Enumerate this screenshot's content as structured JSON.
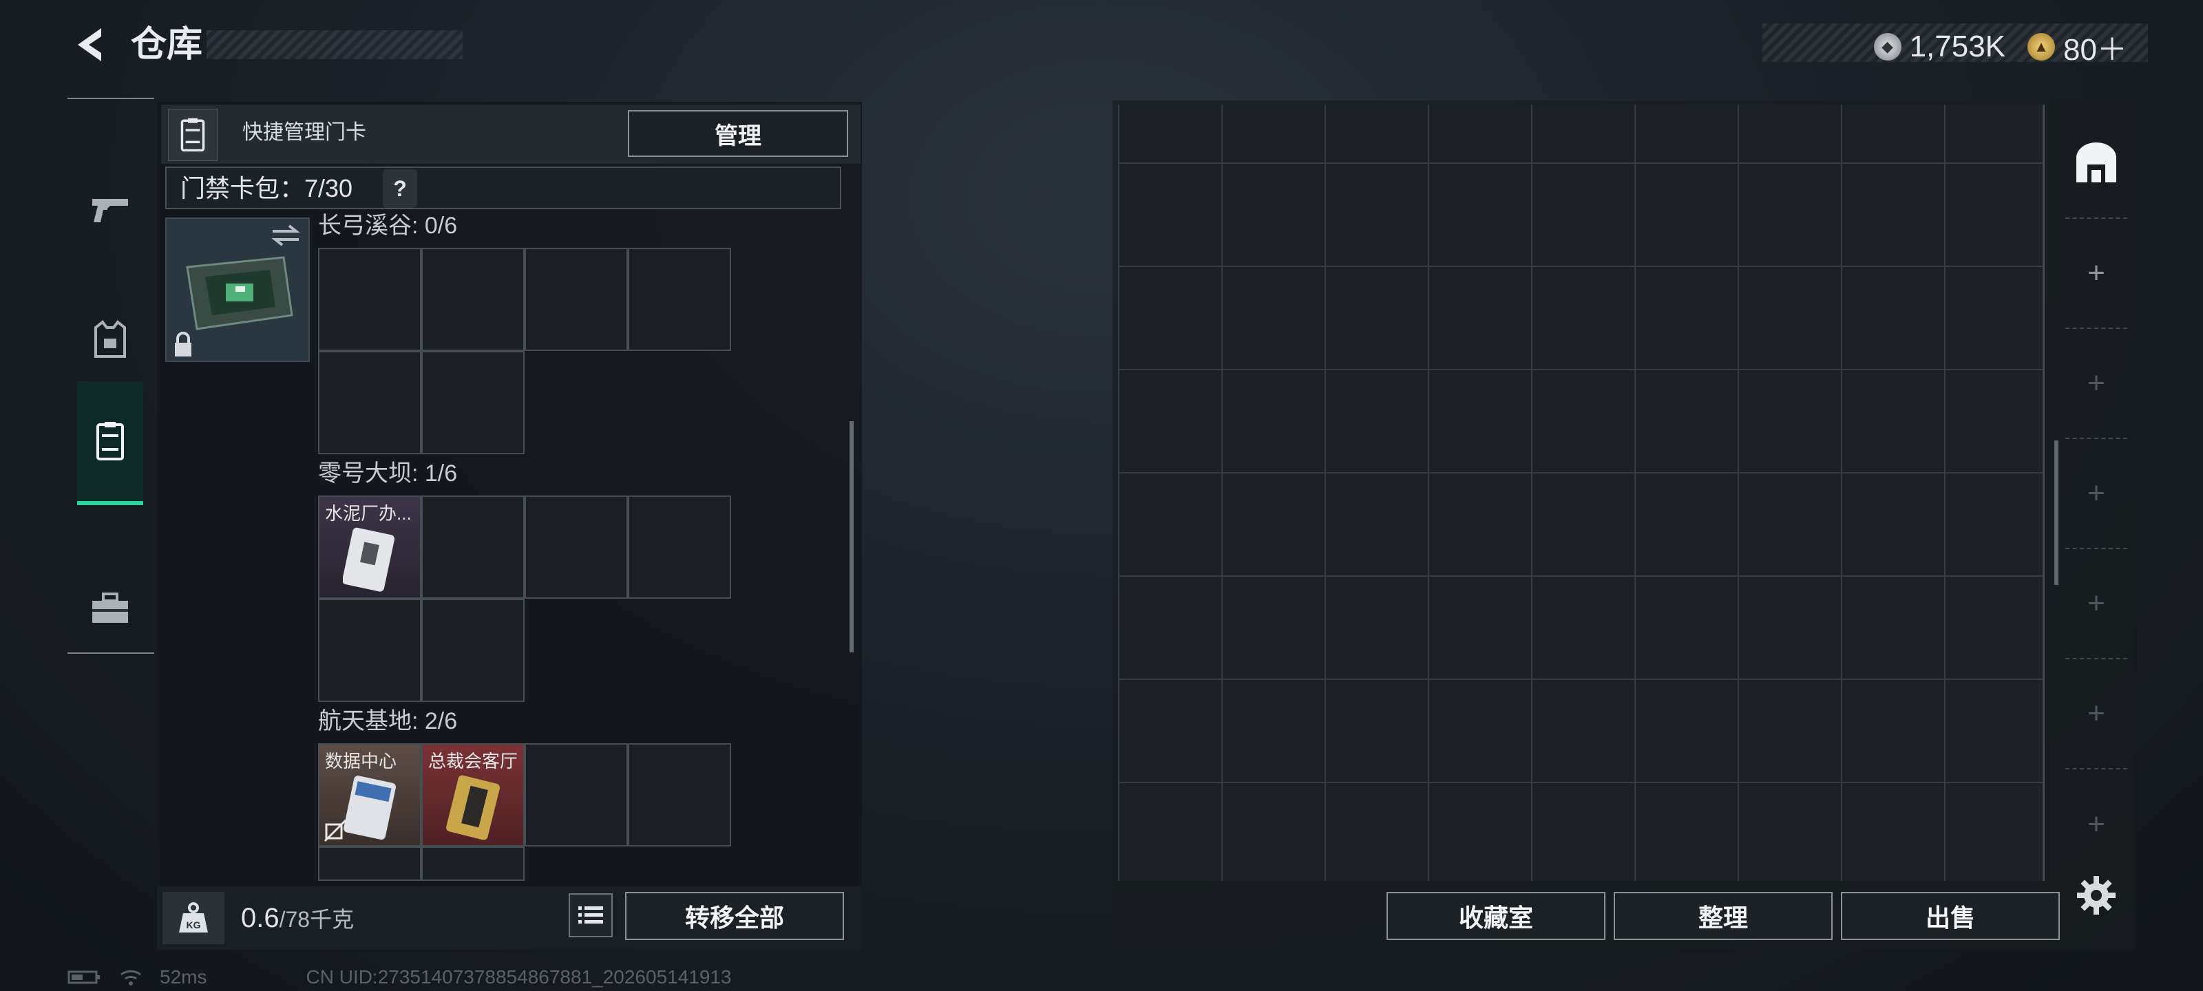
{
  "header": {
    "title": "仓库",
    "currency": [
      {
        "icon": "silver-coin-icon",
        "value": "1,753K"
      },
      {
        "icon": "gold-triangle-coin-icon",
        "value": "80＋"
      }
    ]
  },
  "nav": {
    "items": [
      {
        "name": "weapons-tab",
        "icon": "pistol-icon",
        "active": false
      },
      {
        "name": "gear-tab",
        "icon": "armor-vest-icon",
        "active": false
      },
      {
        "name": "keycards-tab",
        "icon": "keycard-icon",
        "active": true
      },
      {
        "name": "supplies-tab",
        "icon": "toolbox-icon",
        "active": false
      }
    ]
  },
  "card_panel": {
    "quick_label": "快捷管理门卡",
    "manage_label": "管理",
    "pack_label": "门禁卡包：7/30",
    "pack_help": "?",
    "regions": [
      {
        "title": "长弓溪谷: 0/6",
        "slots": []
      },
      {
        "title": "零号大坝: 1/6",
        "slots": [
          {
            "label": "水泥厂办...",
            "rarity": "purple"
          }
        ]
      },
      {
        "title": "航天基地: 2/6",
        "slots": [
          {
            "label": "数据中心",
            "rarity": "blue"
          },
          {
            "label": "总裁会客厅",
            "rarity": "red"
          }
        ]
      }
    ],
    "weight_current": "0.6",
    "weight_max": "/78千克",
    "weight_icon_text": "KG",
    "transfer_all_label": "转移全部"
  },
  "storage": {
    "buttons": {
      "collection": "收藏室",
      "organize": "整理",
      "sell": "出售"
    },
    "rail_plus": "+"
  },
  "status": {
    "ping": "52ms",
    "uid": "CN UID:27351407378854867881_202605141913"
  },
  "colors": {
    "accent_green": "#2bd39b",
    "rarity_purple": "#3d3548",
    "rarity_blue": "#5c4d46",
    "rarity_red": "#7a3235"
  }
}
